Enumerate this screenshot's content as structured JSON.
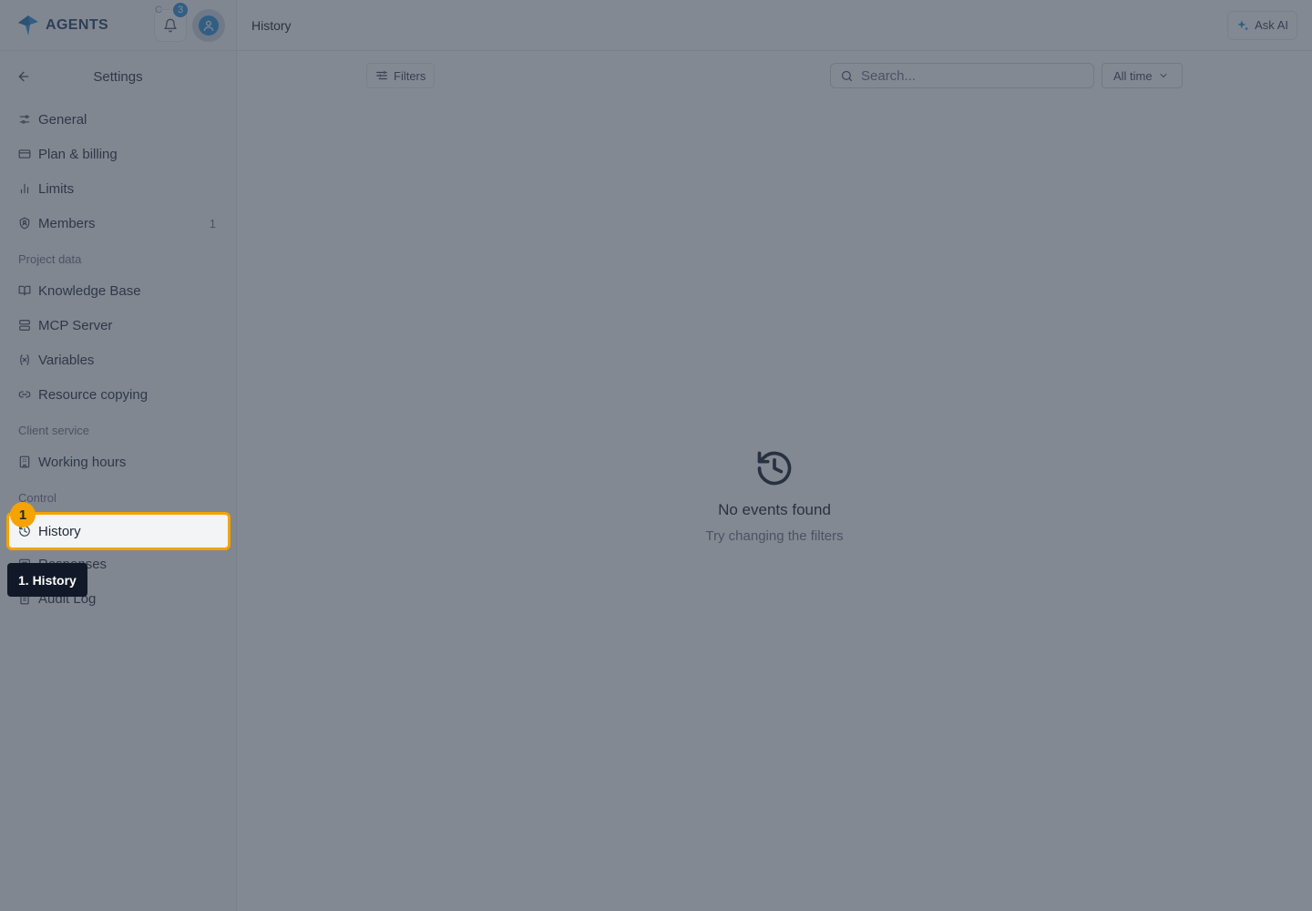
{
  "brand": {
    "name": "AGENTS"
  },
  "header": {
    "notifications_count": "3",
    "spinner": "C"
  },
  "settings": {
    "title": "Settings"
  },
  "nav": {
    "general": "General",
    "plan_billing": "Plan & billing",
    "limits": "Limits",
    "members": "Members",
    "members_count": "1",
    "group_project_data": "Project data",
    "knowledge_base": "Knowledge Base",
    "mcp_server": "MCP Server",
    "variables": "Variables",
    "resource_copying": "Resource copying",
    "group_client_service": "Client service",
    "working_hours": "Working hours",
    "group_control": "Control",
    "history": "History",
    "responses": "Responses",
    "audit_log": "Audit Log"
  },
  "main": {
    "page_title": "History",
    "ask_ai": "Ask AI",
    "filters": "Filters",
    "search_placeholder": "Search...",
    "time_range": "All time",
    "empty_title": "No events found",
    "empty_subtitle": "Try changing the filters"
  },
  "guide": {
    "step_number": "1",
    "step_label": "1. History"
  },
  "colors": {
    "accent": "#2b8fd6",
    "highlight": "#f4a300",
    "tooltip_bg": "#111827"
  }
}
